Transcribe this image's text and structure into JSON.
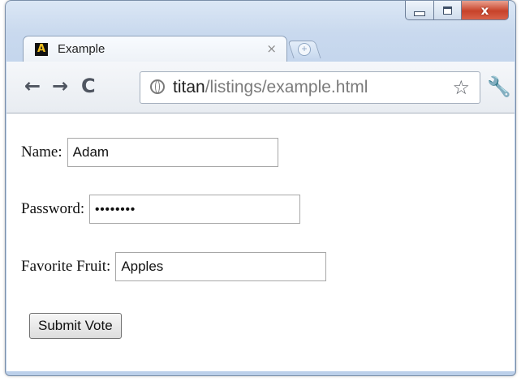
{
  "window": {
    "controls": {
      "close_glyph": "x"
    }
  },
  "tab": {
    "favicon_letter": "A",
    "title": "Example",
    "close_glyph": "×"
  },
  "toolbar": {
    "back_glyph": "←",
    "forward_glyph": "→",
    "reload_glyph": "C",
    "url_host": "titan",
    "url_path": "/listings/example.html",
    "bookmark_glyph": "☆",
    "wrench_glyph": "🔧"
  },
  "form": {
    "name_label": "Name:",
    "name_value": "Adam",
    "password_label": "Password:",
    "password_value": "••••••••",
    "fruit_label": "Favorite Fruit:",
    "fruit_value": "Apples",
    "submit_label": "Submit Vote"
  }
}
